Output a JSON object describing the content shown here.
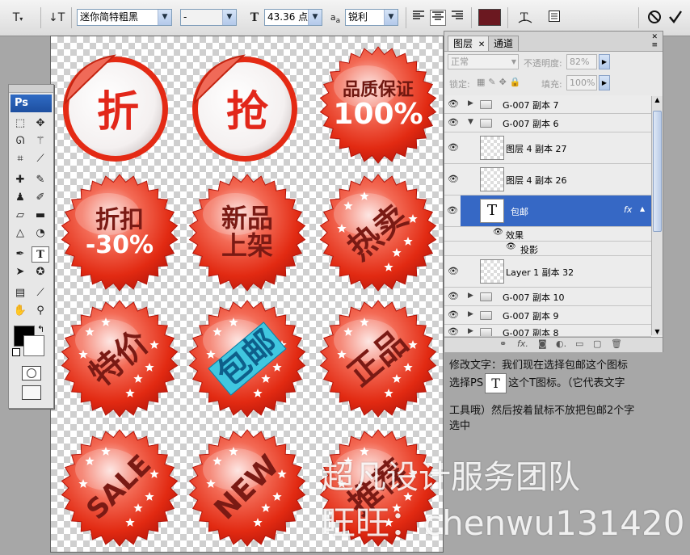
{
  "options_bar": {
    "font_family": "迷你简特粗黑",
    "font_style": "-",
    "font_size": "43.36 点",
    "aa_prefix": "a",
    "aa_sub": "a",
    "anti_alias": "锐利",
    "text_color": "#6b1820"
  },
  "toolbox": {
    "title": "Ps"
  },
  "badges": {
    "b1": "折",
    "b2": "抢",
    "b3a": "品质保证",
    "b3b": "100%",
    "b4a": "折扣",
    "b4b": "-30%",
    "b5a": "新品",
    "b5b": "上架",
    "b6": "热卖",
    "b7": "特价",
    "b8": "包邮",
    "b9": "正品",
    "b10": "SALE",
    "b11": "NEW",
    "b12": "推荐"
  },
  "layers_panel": {
    "tab_layers": "图层",
    "tab_channels": "通道",
    "blend_mode": "正常",
    "opacity_label": "不透明度:",
    "opacity_value": "82%",
    "lock_label": "锁定:",
    "fill_label": "填充:",
    "fill_value": "100%",
    "layers": [
      {
        "name": "G-007 副本 7"
      },
      {
        "name": "G-007 副本 6"
      },
      {
        "name": "图层 4 副本 27"
      },
      {
        "name": "图层 4 副本 26"
      },
      {
        "name": "包邮"
      },
      {
        "name": "效果"
      },
      {
        "name": "投影"
      },
      {
        "name": "Layer 1 副本 32"
      },
      {
        "name": "G-007 副本 10"
      },
      {
        "name": "G-007 副本 9"
      },
      {
        "name": "G-007 副本 8"
      }
    ]
  },
  "annotation": {
    "line1": "修改文字：我们现在选择包邮这个图标",
    "line2a": "选择PS",
    "t_icon": "T",
    "line2b": "这个T图标。（它代表文字",
    "line3": "工具哦）然后按着鼠标不放把包邮2个字",
    "line4": "选中"
  },
  "watermark": {
    "line1": "超凡设计服务团队",
    "line2": "旺旺：chenwu131420"
  }
}
